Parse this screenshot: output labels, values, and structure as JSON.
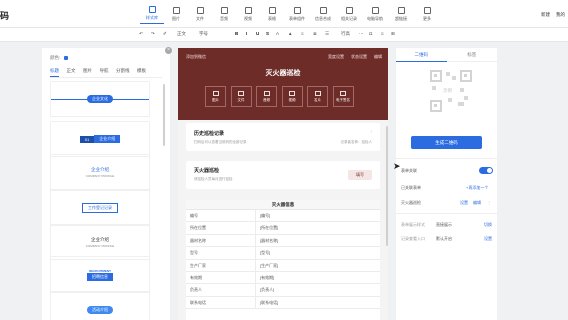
{
  "app": {
    "logo": "码"
  },
  "toolbar": {
    "tools": [
      {
        "label": "样式库",
        "icon": "style-library-icon",
        "active": true
      },
      {
        "label": "图片",
        "icon": "image-icon"
      },
      {
        "label": "文件",
        "icon": "file-icon"
      },
      {
        "label": "音频",
        "icon": "audio-icon"
      },
      {
        "label": "视频",
        "icon": "video-icon"
      },
      {
        "label": "表格",
        "icon": "table-icon"
      },
      {
        "label": "表单组件",
        "icon": "form-component-icon"
      },
      {
        "label": "信息合成",
        "icon": "merge-icon"
      },
      {
        "label": "相关记录",
        "icon": "records-icon"
      },
      {
        "label": "电脑导航",
        "icon": "nav-icon"
      },
      {
        "label": "超链接",
        "icon": "link-icon"
      },
      {
        "label": "更多",
        "icon": "more-icon"
      }
    ],
    "right_new": "新建",
    "right_mine": "我的"
  },
  "format": {
    "items": [
      "↶",
      "↷",
      "✐",
      "正文",
      "字号",
      "B",
      "I",
      "U",
      "S",
      "A",
      "▲",
      "≡",
      "≣",
      "☰",
      "行高",
      "⋯",
      "Ω",
      "☺",
      "⊞"
    ]
  },
  "left_panel": {
    "color_label": "颜色:",
    "close": "×",
    "tabs": [
      "标题",
      "正文",
      "图片",
      "导航",
      "分割线",
      "模板"
    ],
    "templates": [
      {
        "text": "企业文化"
      },
      {
        "badge": "01",
        "text": "企业介绍"
      },
      {
        "text": "企业介绍",
        "sub": "COMPANY PROFILE"
      },
      {
        "text": "工作登记记录"
      },
      {
        "text": "企业介绍",
        "sub": "COMPANY PROFILE"
      },
      {
        "sub": "RECRUITMENT",
        "text": "招聘信息"
      },
      {
        "text": "活动介绍"
      }
    ]
  },
  "phone": {
    "hero": {
      "visitor": "添加到微信",
      "settings": "宽度设置",
      "status": "状态设置",
      "edit": "编辑",
      "title": "灭火器巡检",
      "buttons": [
        "图片",
        "文件",
        "音频",
        "视频",
        "名片",
        "电子签名"
      ]
    },
    "history": {
      "title": "历史巡检记录",
      "sub": "扫码后可以查看当前码的全部记录",
      "meta": "记录者名称：巡检人"
    },
    "card2": {
      "title": "灭火器巡检",
      "sub": "请巡检人员每月进行巡检",
      "button": "填写"
    },
    "info": {
      "title": "灭火器信息",
      "rows": [
        {
          "k": "编号",
          "v": "[编号]"
        },
        {
          "k": "所在位置",
          "v": "[所在位置]"
        },
        {
          "k": "器材名称",
          "v": "[器材名称]"
        },
        {
          "k": "型号",
          "v": "[型号]"
        },
        {
          "k": "生产厂家",
          "v": "[生产厂家]"
        },
        {
          "k": "有效期",
          "v": "[有效期]"
        },
        {
          "k": "负责人",
          "v": "[负责人]"
        },
        {
          "k": "联系电话",
          "v": "[联系电话]"
        }
      ]
    }
  },
  "right_panel": {
    "tabs": [
      "二维码",
      "标签"
    ],
    "qr_placeholder": "示例",
    "generate_button": "生成二维码",
    "form_label": "表单关联",
    "linked_label": "已关联表单",
    "add_one": "+再添加一个",
    "form_name": "灭火器巡检",
    "form_actions": [
      "设置",
      "编辑"
    ],
    "show_to_label": "表单展示样式",
    "show_to_value": "直接展示",
    "show_to_action": "切换",
    "record_label": "记录查看入口",
    "record_value": "默认开启",
    "record_action": "设置"
  }
}
